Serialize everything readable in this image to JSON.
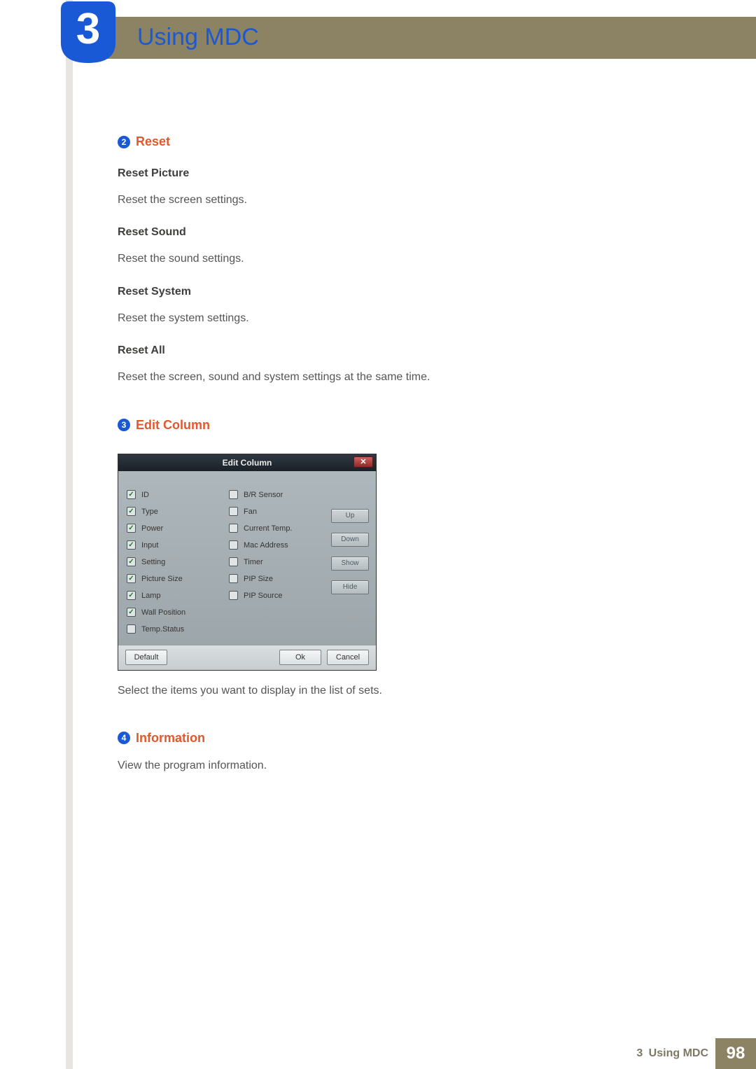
{
  "chapter": {
    "number": "3",
    "title": "Using MDC"
  },
  "sections": {
    "reset": {
      "num": "2",
      "label": "Reset",
      "items": [
        {
          "head": "Reset Picture",
          "body": "Reset the screen settings."
        },
        {
          "head": "Reset Sound",
          "body": "Reset the sound settings."
        },
        {
          "head": "Reset System",
          "body": "Reset the system settings."
        },
        {
          "head": "Reset All",
          "body": "Reset the screen, sound and system settings at the same time."
        }
      ]
    },
    "edit_column": {
      "num": "3",
      "label": "Edit Column",
      "caption": "Select the items you want to display in the list of sets.",
      "dialog": {
        "title": "Edit Column",
        "close_glyph": "✕",
        "col1": [
          {
            "label": "ID",
            "checked": true
          },
          {
            "label": "Type",
            "checked": true
          },
          {
            "label": "Power",
            "checked": true
          },
          {
            "label": "Input",
            "checked": true
          },
          {
            "label": "Setting",
            "checked": true
          },
          {
            "label": "Picture Size",
            "checked": true
          },
          {
            "label": "Lamp",
            "checked": true
          },
          {
            "label": "Wall Position",
            "checked": true
          },
          {
            "label": "Temp.Status",
            "checked": false
          }
        ],
        "col2": [
          {
            "label": "B/R Sensor",
            "checked": false
          },
          {
            "label": "Fan",
            "checked": false
          },
          {
            "label": "Current Temp.",
            "checked": false
          },
          {
            "label": "Mac Address",
            "checked": false
          },
          {
            "label": "Timer",
            "checked": false
          },
          {
            "label": "PIP Size",
            "checked": false
          },
          {
            "label": "PIP Source",
            "checked": false
          }
        ],
        "buttons": {
          "up": "Up",
          "down": "Down",
          "show": "Show",
          "hide": "Hide"
        },
        "footer": {
          "default": "Default",
          "ok": "Ok",
          "cancel": "Cancel"
        }
      }
    },
    "information": {
      "num": "4",
      "label": "Information",
      "body": "View the program information."
    }
  },
  "footer": {
    "chapter_ref": "3",
    "title": "Using MDC",
    "page": "98"
  }
}
